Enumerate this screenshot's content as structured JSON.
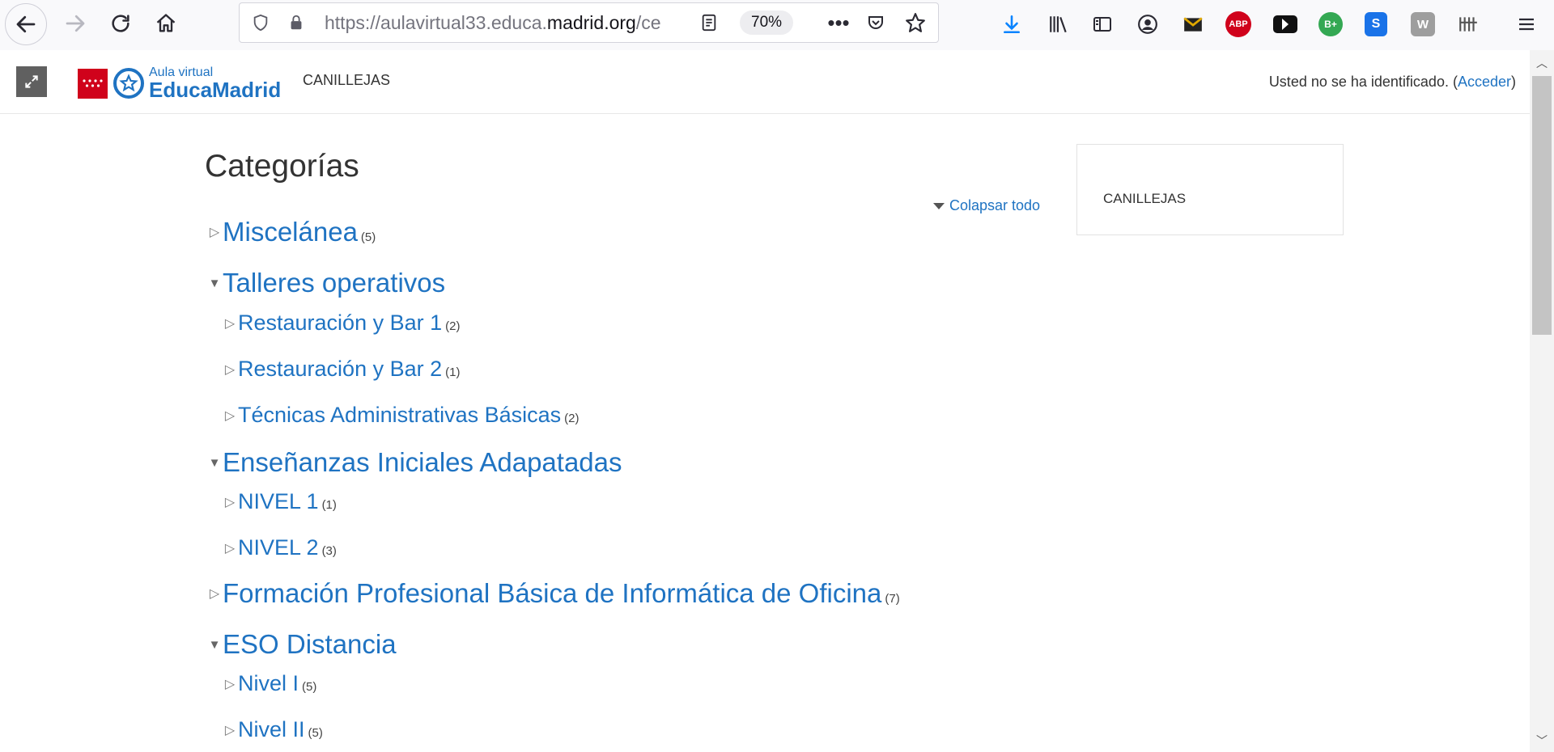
{
  "browser": {
    "url_prefix": "https://aulavirtual33.educa.",
    "url_domain": "madrid.org",
    "url_suffix": "/ce",
    "zoom": "70%",
    "ext_abp": "ABP",
    "ext_bplus": "B+",
    "ext_s": "S",
    "ext_w": "W"
  },
  "header": {
    "logo_small": "Aula virtual",
    "logo_big": "EducaMadrid",
    "site_name": "CANILLEJAS",
    "login_prefix": "Usted no se ha identificado. (",
    "login_link": "Acceder",
    "login_suffix": ")"
  },
  "main": {
    "title": "Categorías",
    "collapse_label": "Colapsar todo",
    "categories": [
      {
        "name": "Miscelánea",
        "count": "(5)"
      },
      {
        "name": "Talleres operativos",
        "count": ""
      },
      {
        "name": "Restauración y Bar 1",
        "count": "(2)"
      },
      {
        "name": "Restauración y Bar 2",
        "count": "(1)"
      },
      {
        "name": "Técnicas Administrativas Básicas",
        "count": "(2)"
      },
      {
        "name": "Enseñanzas Iniciales Adapatadas",
        "count": ""
      },
      {
        "name": "NIVEL 1",
        "count": "(1)"
      },
      {
        "name": "NIVEL 2",
        "count": "(3)"
      },
      {
        "name": "Formación Profesional Básica de Informática de Oficina",
        "count": "(7)"
      },
      {
        "name": "ESO Distancia",
        "count": ""
      },
      {
        "name": "Nivel I",
        "count": "(5)"
      },
      {
        "name": "Nivel II",
        "count": "(5)"
      }
    ]
  },
  "sidebar": {
    "block_text": "CANILLEJAS"
  }
}
